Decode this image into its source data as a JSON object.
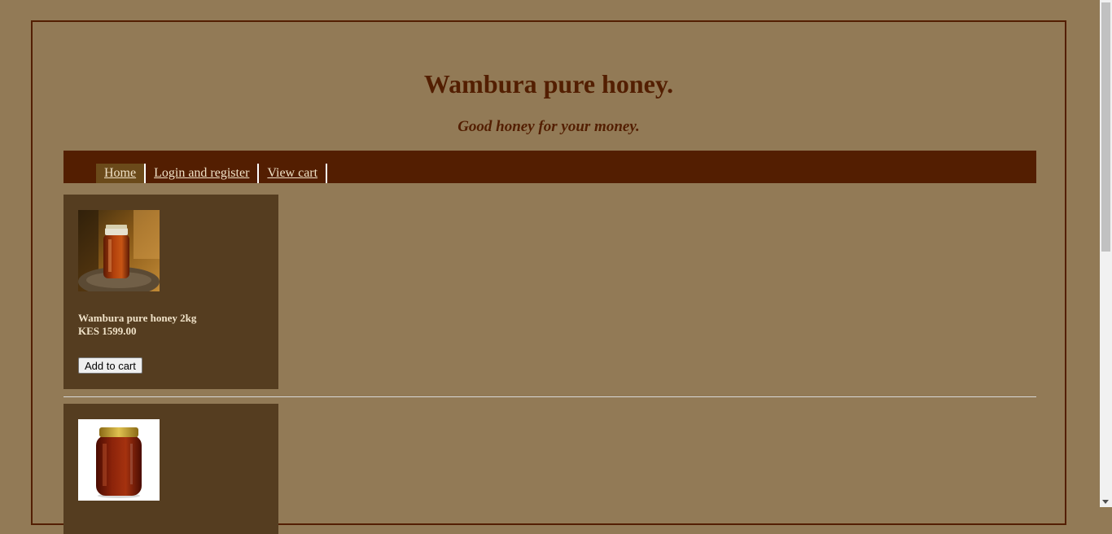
{
  "header": {
    "title": "Wambura pure honey.",
    "tagline": "Good honey for your money."
  },
  "nav": {
    "items": [
      {
        "label": "Home",
        "active": true
      },
      {
        "label": "Login and register",
        "active": false
      },
      {
        "label": "View cart",
        "active": false
      }
    ]
  },
  "products": [
    {
      "name": "Wambura pure honey 2kg",
      "price": "KES 1599.00",
      "button_label": "Add to cart",
      "image": "honey-jar-on-stump"
    },
    {
      "image": "honey-jar-white-background"
    }
  ],
  "colors": {
    "background": "#927a56",
    "accent": "#531e01",
    "card": "#553d20",
    "nav_active": "#6b4a1a",
    "link_text": "#f0e2c8"
  }
}
